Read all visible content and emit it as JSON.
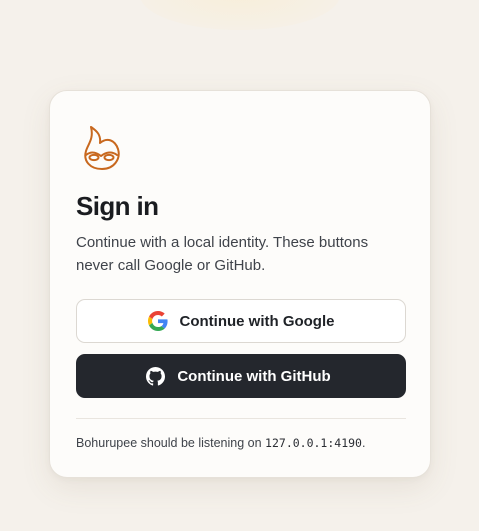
{
  "page": {
    "title": "Sign in",
    "subtitle": "Continue with a local identity. These buttons never call Google or GitHub."
  },
  "logo": {
    "icon": "mask-flame-icon",
    "color": "#c8681e"
  },
  "buttons": {
    "google": {
      "label": "Continue with Google",
      "icon": "google-icon"
    },
    "github": {
      "label": "Continue with GitHub",
      "icon": "github-icon",
      "background": "#24272d"
    }
  },
  "footer": {
    "prefix": "Bohurupee should be listening on ",
    "address": "127.0.0.1:4190",
    "suffix": "."
  },
  "colors": {
    "page_background": "#f5f1eb",
    "card_background": "#fdfcfa",
    "accent": "#c8681e"
  }
}
